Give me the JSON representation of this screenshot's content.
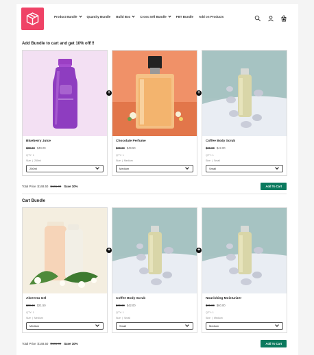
{
  "header": {
    "logo": "box-logo",
    "nav": [
      {
        "label": "Product Bundle",
        "has_dropdown": true
      },
      {
        "label": "Quantity Bundle",
        "has_dropdown": false
      },
      {
        "label": "Build Box",
        "has_dropdown": true
      },
      {
        "label": "Cross Sell Bundle",
        "has_dropdown": true
      },
      {
        "label": "FBT Bundle",
        "has_dropdown": false
      },
      {
        "label": "Add on Products",
        "has_dropdown": false
      }
    ],
    "icons": [
      "search-icon",
      "account-icon",
      "cart-icon"
    ],
    "cart_count": "1"
  },
  "bundle1": {
    "title": "Add Bundle to cart and get 10% off!!!",
    "products": [
      {
        "name": "Blueberry Juice",
        "old_price": "$00.00",
        "price": "$49.00",
        "qty": "QTY: 1",
        "opt_label": "Size",
        "opt_value": "250ml",
        "selected": "250ml",
        "image": "juice-bottle"
      },
      {
        "name": "Chocolate Perfume",
        "old_price": "$00.00",
        "price": "$49.50",
        "qty": "QTY: 1",
        "opt_label": "Size",
        "opt_value": "Medium",
        "selected": "Medium",
        "image": "perfume-bottle"
      },
      {
        "name": "Coffee Body Scrub",
        "old_price": "$00.00",
        "price": "$42.00",
        "qty": "QTY: 1",
        "opt_label": "Size",
        "opt_value": "Small",
        "selected": "Small",
        "image": "scrub-bottle"
      }
    ],
    "total_label": "Total Price",
    "total_price": "$148.50",
    "total_old": "$165.00",
    "save": "Save 10%",
    "button": "Add To Cart"
  },
  "bundle2": {
    "title": "Cart Bundle",
    "products": [
      {
        "name": "Aloevera Gel",
        "old_price": "$00.00",
        "price": "$21.50",
        "qty": "QTY: 1",
        "opt_label": "Size",
        "opt_value": "Medium",
        "selected": "Medium",
        "image": "gel-bottles"
      },
      {
        "name": "Coffee Body Scrub",
        "old_price": "$00.00",
        "price": "$42.00",
        "qty": "QTY: 1",
        "opt_label": "Size",
        "opt_value": "Small",
        "selected": "Small",
        "image": "scrub-bottle"
      },
      {
        "name": "Nourishing Moisturizer",
        "old_price": "$00.00",
        "price": "$60.00",
        "qty": "QTY: 1",
        "opt_label": "Size",
        "opt_value": "Medium",
        "selected": "Medium",
        "image": "scrub-bottle"
      }
    ],
    "total_label": "Total Price",
    "total_price": "$148.50",
    "total_old": "$165.00",
    "save": "Save 10%",
    "button": "Add To Cart"
  },
  "colors": {
    "accent": "#0b7a5e",
    "logo": "#ef4266"
  }
}
